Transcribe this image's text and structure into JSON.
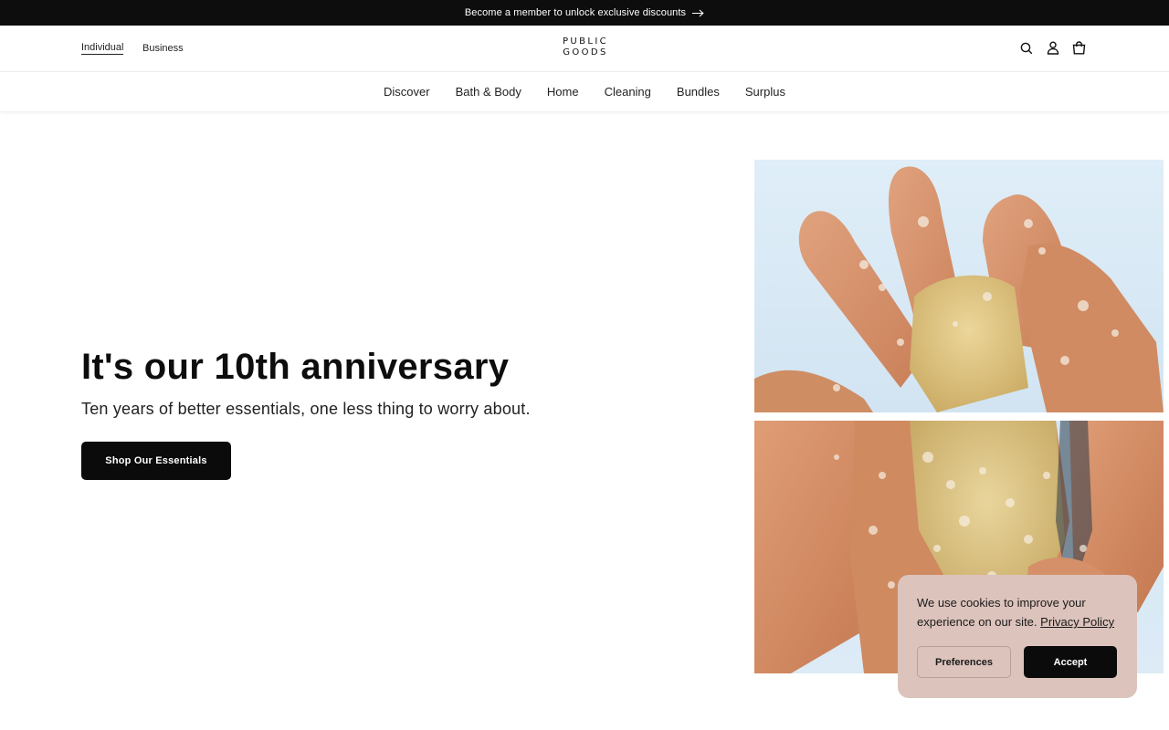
{
  "announcement": {
    "text": "Become a member to unlock exclusive discounts",
    "arrow_icon": "arrow-right-icon"
  },
  "header": {
    "segments": [
      {
        "label": "Individual",
        "active": true
      },
      {
        "label": "Business",
        "active": false
      }
    ],
    "logo": {
      "line1": "PUBLIC",
      "line2": "GOODS"
    },
    "icons": [
      "search-icon",
      "account-icon",
      "cart-icon"
    ]
  },
  "nav": {
    "items": [
      "Discover",
      "Bath & Body",
      "Home",
      "Cleaning",
      "Bundles",
      "Surplus"
    ]
  },
  "hero": {
    "title": "It's our 10th anniversary",
    "subtitle": "Ten years of better essentials, one less thing to worry about.",
    "cta_label": "Shop Our Essentials"
  },
  "cookie": {
    "text": "We use cookies to improve your experience on our site.",
    "link_label": "Privacy Policy",
    "preferences_label": "Preferences",
    "accept_label": "Accept"
  },
  "colors": {
    "announcement_bg": "#0d0d0d",
    "cta_bg": "#0b0b0b",
    "cookie_bg": "#dcc3bc",
    "photo_sky": "#dcebf6"
  }
}
